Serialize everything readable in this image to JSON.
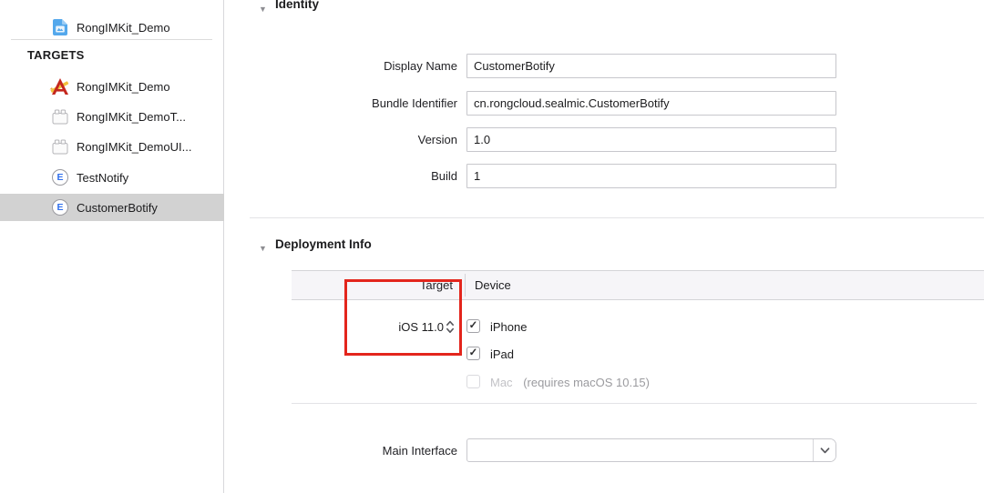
{
  "colors": {
    "annotation_red": "#e3251c",
    "selected_row_bg": "#d2d2d2",
    "extension_badge_blue": "#2f6fed"
  },
  "sidebar": {
    "project": {
      "label": "RongIMKit_Demo",
      "icon": "project-file-icon"
    },
    "targets_header": "TARGETS",
    "targets": [
      {
        "label": "RongIMKit_Demo",
        "icon": "app-target-icon",
        "badge": "",
        "selected": false
      },
      {
        "label": "RongIMKit_DemoT...",
        "icon": "test-bundle-icon",
        "badge": "",
        "selected": false
      },
      {
        "label": "RongIMKit_DemoUI...",
        "icon": "test-bundle-icon",
        "badge": "",
        "selected": false
      },
      {
        "label": "TestNotify",
        "icon": "app-extension-icon",
        "badge": "E",
        "selected": false
      },
      {
        "label": "CustomerBotify",
        "icon": "app-extension-icon",
        "badge": "E",
        "selected": true
      }
    ]
  },
  "identity": {
    "title": "Identity",
    "fields": [
      {
        "label": "Display Name",
        "value": "CustomerBotify"
      },
      {
        "label": "Bundle Identifier",
        "value": "cn.rongcloud.sealmic.CustomerBotify"
      },
      {
        "label": "Version",
        "value": "1.0"
      },
      {
        "label": "Build",
        "value": "1"
      }
    ]
  },
  "deployment": {
    "title": "Deployment Info",
    "table": {
      "target_column": "Target",
      "device_column": "Device"
    },
    "target_os": "iOS 11.0",
    "devices": [
      {
        "label": "iPhone",
        "checked": true,
        "check_glyph": "✓",
        "enabled": true,
        "note": ""
      },
      {
        "label": "iPad",
        "checked": true,
        "check_glyph": "✓",
        "enabled": true,
        "note": ""
      },
      {
        "label": "Mac",
        "checked": false,
        "check_glyph": "",
        "enabled": false,
        "note": "(requires macOS 10.15)"
      }
    ]
  },
  "main_interface": {
    "label": "Main Interface",
    "value": ""
  }
}
